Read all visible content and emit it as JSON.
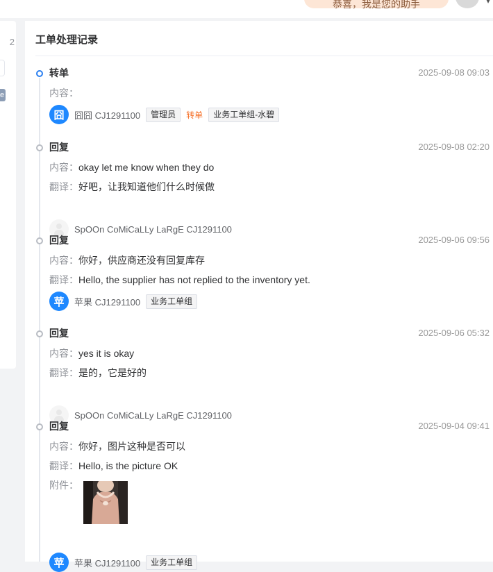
{
  "topbar": {
    "notice": "恭喜，我是您的助手"
  },
  "left": {
    "count": "2",
    "badge": "e"
  },
  "panel": {
    "title": "工单处理记录"
  },
  "labels": {
    "content": "内容：",
    "translation": "翻译：",
    "attachment": "附件："
  },
  "records": [
    {
      "type": "转单",
      "time": "2025-09-08 09:03",
      "active": true,
      "content": "",
      "author": {
        "avatar": "囧",
        "name": "囧囧 CJ1291100",
        "tags": [
          "管理员"
        ],
        "action": "转单",
        "target": "业务工单组-水碧"
      }
    },
    {
      "type": "回复",
      "time": "2025-09-08 02:20",
      "content": "okay let me know when they do",
      "translation": "好吧，让我知道他们什么时候做",
      "author": {
        "avatar": "",
        "name": "SpOOn CoMiCaLLy LaRgE CJ1291100"
      }
    },
    {
      "type": "回复",
      "time": "2025-09-06 09:56",
      "content": "你好，供应商还没有回复库存",
      "translation": "Hello, the supplier has not replied to the inventory yet.",
      "author": {
        "avatar": "苹",
        "name": "苹果 CJ1291100",
        "tags": [
          "业务工单组"
        ]
      }
    },
    {
      "type": "回复",
      "time": "2025-09-06 05:32",
      "content": "yes it is okay",
      "translation": "是的，它是好的",
      "author": {
        "avatar": "",
        "name": "SpOOn CoMiCaLLy LaRgE CJ1291100"
      }
    },
    {
      "type": "回复",
      "time": "2025-09-04 09:41",
      "content": "你好，图片这种是否可以",
      "translation": "Hello, is the picture OK",
      "attachment": "product-photo",
      "author": {
        "avatar": "苹",
        "name": "苹果 CJ1291100",
        "tags": [
          "业务工单组"
        ]
      }
    }
  ],
  "colors": {
    "accent": "#1e88ff",
    "transfer": "#f56c22",
    "muted": "#909399"
  }
}
